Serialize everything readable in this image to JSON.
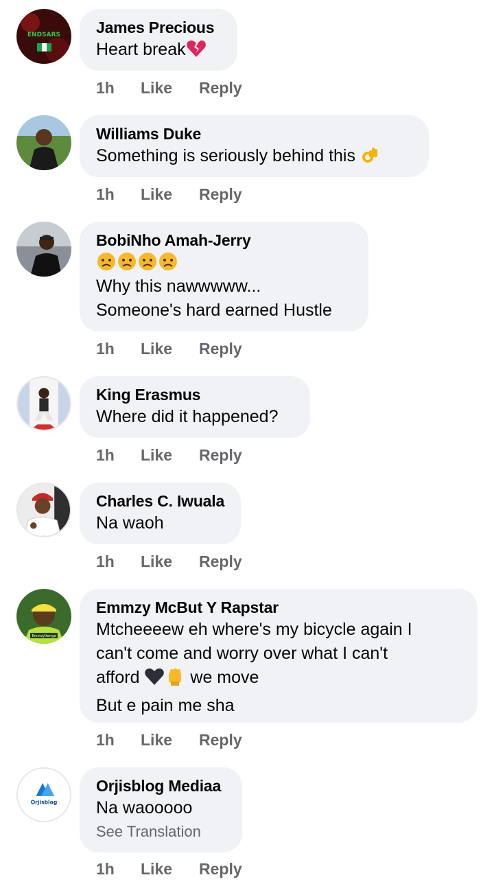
{
  "comments": [
    {
      "author": "James Precious",
      "lines": [
        "Heart break"
      ],
      "time": "1h",
      "like": "Like",
      "reply": "Reply",
      "emoji_icon": "broken-heart-icon"
    },
    {
      "author": "Williams Duke",
      "lines": [
        "Something is seriously behind this "
      ],
      "time": "1h",
      "like": "Like",
      "reply": "Reply",
      "emoji_icon": "ok-hand-icon"
    },
    {
      "author": "BobiNho Amah-Jerry",
      "lines": [
        "",
        "Why this nawwwww...",
        "Someone's hard earned Hustle"
      ],
      "time": "1h",
      "like": "Like",
      "reply": "Reply",
      "emoji_icon": "sad-face-icon"
    },
    {
      "author": "King Erasmus",
      "lines": [
        "Where did it happened?"
      ],
      "time": "1h",
      "like": "Like",
      "reply": "Reply"
    },
    {
      "author": "Charles C. Iwuala",
      "lines": [
        "Na waoh"
      ],
      "time": "1h",
      "like": "Like",
      "reply": "Reply"
    },
    {
      "author": "Emmzy McBut Y Rapstar",
      "lines": [
        "Mtcheeeew eh  where's my bicycle again I",
        "can't come and worry over what   I can't",
        "afford ",
        "But e pain me sha"
      ],
      "line3_suffix": " we move",
      "time": "1h",
      "like": "Like",
      "reply": "Reply",
      "emoji_icons": [
        "black-heart-icon",
        "raised-fist-icon"
      ]
    },
    {
      "author": "Orjisblog Mediaa",
      "lines": [
        "Na waooooo"
      ],
      "see_translation": "See Translation",
      "time": "1h",
      "like": "Like",
      "reply": "Reply"
    }
  ],
  "avatar_overlays": {
    "c1": "ENDSARS",
    "c6": "Emmzylkenga",
    "c7": "Orjisblog"
  },
  "colors": {
    "bubble": "#f0f2f5",
    "meta": "#65676b",
    "text": "#050505"
  }
}
